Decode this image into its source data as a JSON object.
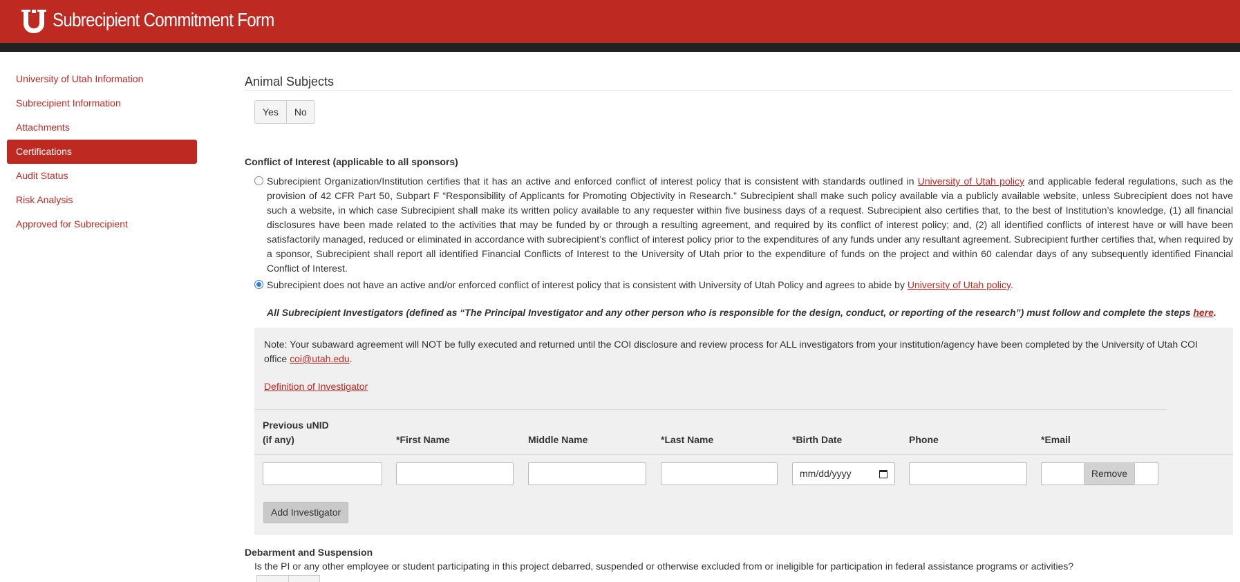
{
  "header": {
    "title": "Subrecipient Commitment Form",
    "brand_color": "#be2a22"
  },
  "sidebar": {
    "items": [
      {
        "label": "University of Utah Information"
      },
      {
        "label": "Subrecipient Information"
      },
      {
        "label": "Attachments"
      },
      {
        "label": "Certifications",
        "active": true
      },
      {
        "label": "Audit Status"
      },
      {
        "label": "Risk Analysis"
      },
      {
        "label": "Approved for Subrecipient"
      }
    ]
  },
  "animal_subjects": {
    "title": "Animal Subjects",
    "yes_label": "Yes",
    "no_label": "No"
  },
  "coi": {
    "heading": "Conflict of Interest (applicable to all sponsors)",
    "option1": {
      "text_before": "Subrecipient Organization/Institution certifies that it has an active and enforced conflict of interest policy that is consistent with standards outlined in ",
      "link": "University of Utah policy",
      "text_after": " and applicable federal regulations, such as the provision of 42 CFR Part 50, Subpart F “Responsibility of Applicants for Promoting Objectivity in Research.” Subrecipient shall make such policy available via a publicly available website, unless Subrecipient does not have such a website, in which case Subrecipient shall make its written policy available to any requester within five business days of a request. Subrecipient also certifies that, to the best of Institution’s knowledge, (1) all financial disclosures have been made related to the activities that may be funded by or through a resulting agreement, and required by its conflict of interest policy; and, (2) all identified conflicts of interest have or will have been satisfactorily managed, reduced or eliminated in accordance with subrecipient’s conflict of interest policy prior to the expenditures of any funds under any resultant agreement. Subrecipient further certifies that, when required by a sponsor, Subrecipient shall report all identified Financial Conflicts of Interest to the University of Utah prior to the expenditure of funds on the project and within 60 calendar days of any subsequently identified Financial Conflict of Interest.",
      "checked": false
    },
    "option2": {
      "text_before": "Subrecipient does not have an active and/or enforced conflict of interest policy that is consistent with University of Utah Policy and agrees to abide by ",
      "link": "University of Utah policy",
      "text_after": ".",
      "checked": true
    },
    "investigators_note_before": "All Subrecipient Investigators (defined as “The Principal Investigator and any other person who is responsible for the design, conduct, or reporting of the research”) must follow and complete the steps ",
    "investigators_note_link": "here",
    "investigators_note_after": ".",
    "panel": {
      "note_before": "Note: Your subaward agreement will NOT be fully executed and returned until the COI disclosure and review process for ALL investigators from your institution/agency have been completed by the University of Utah COI office ",
      "note_email": "coi@utah.edu",
      "note_after": ".",
      "definition_link": "Definition of Investigator",
      "columns": {
        "prev_unid_line1": "Previous uNID",
        "prev_unid_line2": "(if any)",
        "first_name": "*First Name",
        "middle_name": "Middle Name",
        "last_name": "*Last Name",
        "birth_date": "*Birth Date",
        "phone": "Phone",
        "email": "*Email"
      },
      "row": {
        "prev_unid": "",
        "first_name": "",
        "middle_name": "",
        "last_name": "",
        "birth_date_placeholder": "mm/dd/yyyy",
        "phone": "",
        "email": ""
      },
      "remove_label": "Remove",
      "add_label": "Add Investigator"
    }
  },
  "debarment": {
    "heading": "Debarment and Suspension",
    "question": "Is the PI or any other employee or student participating in this project debarred, suspended or otherwise excluded from or ineligible for participation in federal assistance programs or activities?"
  }
}
